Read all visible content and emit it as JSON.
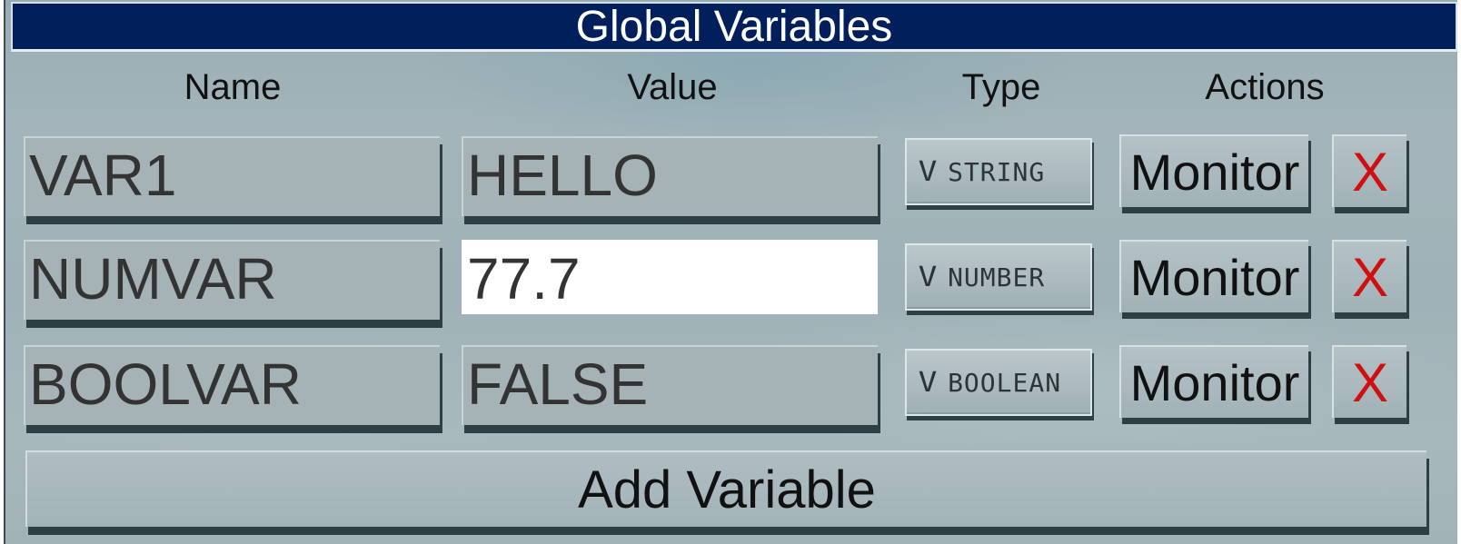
{
  "window": {
    "title": "Global Variables"
  },
  "columns": {
    "name": "Name",
    "value": "Value",
    "type": "Type",
    "actions": "Actions"
  },
  "variables": [
    {
      "name": "VAR1",
      "value": "HELLO",
      "type": "STRING",
      "monitor_label": "Monitor",
      "delete_label": "X"
    },
    {
      "name": "NUMVAR",
      "value": "77.7",
      "type": "NUMBER",
      "monitor_label": "Monitor",
      "delete_label": "X"
    },
    {
      "name": "BOOLVAR",
      "value": "FALSE",
      "type": "BOOLEAN",
      "monitor_label": "Monitor",
      "delete_label": "X"
    }
  ],
  "type_dropdown_icon": "chevron-down-icon",
  "type_dropdown_glyph": "V",
  "add_button_label": "Add Variable",
  "colors": {
    "title_bar": "#001f5b",
    "delete": "#d01010",
    "active_field": "#ffffff"
  }
}
